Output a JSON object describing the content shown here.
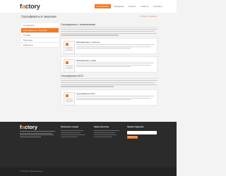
{
  "header": {
    "logo_prefix": "f",
    "logo_mark": "a",
    "logo_rest": "ctory",
    "nav": [
      "Сертификаты",
      "Продукция",
      "Каталог",
      "Новости",
      "Контакты"
    ]
  },
  "page": {
    "title": "Сертификаты и лицензии",
    "breadcrumb_home": "Главная",
    "breadcrumb_sep": " / ",
    "breadcrumb_current": "Лицензии"
  },
  "sidebar": {
    "items": [
      "О компании",
      "Сертификаты и лицензии",
      "Отзывы",
      "Партнеры",
      "Реквизиты"
    ]
  },
  "sections": [
    {
      "title": "Сертификаты с пояснениями"
    },
    {
      "title": "Сертификаты ИСО"
    }
  ],
  "cards": [
    {
      "title": "Изображение с текстом"
    },
    {
      "title": "Изображение слева"
    },
    {
      "title": "Сертификаты ИСО"
    }
  ],
  "footer": {
    "logo_prefix": "f",
    "logo_mark": "a",
    "logo_rest": "ctory",
    "col1_head": "Полезные ссылки",
    "col2_head": "Наши контакты",
    "col3_head": "Форма подписки",
    "subscribe_button": "Подписаться",
    "copyright": "© 2014 Все права защищены"
  },
  "colors": {
    "accent": "#f47a20",
    "footer_bg": "#2b2b2b",
    "page_bg": "#f3f3f3"
  }
}
